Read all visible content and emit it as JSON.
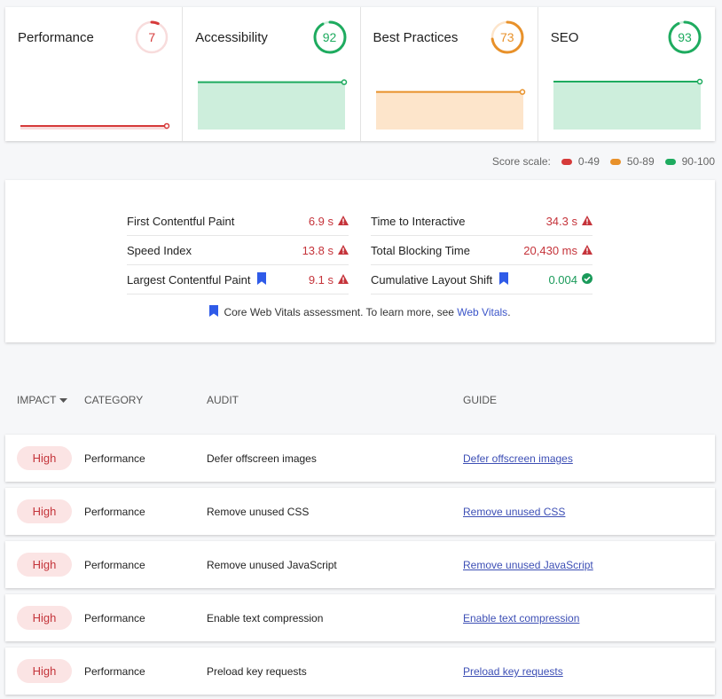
{
  "colors": {
    "poor": "#d63a3a",
    "average": "#e8912a",
    "good": "#1eab5f",
    "poor_fill": "#f8dcdc",
    "average_fill": "#fde5cb",
    "good_fill": "#cdeedc",
    "link": "#3d4fb5"
  },
  "scores": [
    {
      "title": "Performance",
      "value": "7",
      "score": 7,
      "rating": "poor"
    },
    {
      "title": "Accessibility",
      "value": "92",
      "score": 92,
      "rating": "good"
    },
    {
      "title": "Best Practices",
      "value": "73",
      "score": 73,
      "rating": "average"
    },
    {
      "title": "SEO",
      "value": "93",
      "score": 93,
      "rating": "good"
    }
  ],
  "score_scale": {
    "label": "Score scale:",
    "ranges": [
      {
        "label": "0-49",
        "rating": "poor"
      },
      {
        "label": "50-89",
        "rating": "average"
      },
      {
        "label": "90-100",
        "rating": "good"
      }
    ]
  },
  "metrics": [
    {
      "name": "First Contentful Paint",
      "value": "6.9 s",
      "status": "bad",
      "core_web_vital": false
    },
    {
      "name": "Time to Interactive",
      "value": "34.3 s",
      "status": "bad",
      "core_web_vital": false
    },
    {
      "name": "Speed Index",
      "value": "13.8 s",
      "status": "bad",
      "core_web_vital": false
    },
    {
      "name": "Total Blocking Time",
      "value": "20,430 ms",
      "status": "bad",
      "core_web_vital": false
    },
    {
      "name": "Largest Contentful Paint",
      "value": "9.1 s",
      "status": "bad",
      "core_web_vital": true
    },
    {
      "name": "Cumulative Layout Shift",
      "value": "0.004",
      "status": "good",
      "core_web_vital": true
    }
  ],
  "cwv_note": {
    "text": "Core Web Vitals assessment. To learn more, see ",
    "link": "Web Vitals",
    "suffix": "."
  },
  "table": {
    "headers": {
      "impact": "IMPACT",
      "category": "CATEGORY",
      "audit": "AUDIT",
      "guide": "GUIDE"
    },
    "rows": [
      {
        "impact": "High",
        "category": "Performance",
        "audit": "Defer offscreen images",
        "guide": "Defer offscreen images"
      },
      {
        "impact": "High",
        "category": "Performance",
        "audit": "Remove unused CSS",
        "guide": "Remove unused CSS"
      },
      {
        "impact": "High",
        "category": "Performance",
        "audit": "Remove unused JavaScript",
        "guide": "Remove unused JavaScript"
      },
      {
        "impact": "High",
        "category": "Performance",
        "audit": "Enable text compression",
        "guide": "Enable text compression"
      },
      {
        "impact": "High",
        "category": "Performance",
        "audit": "Preload key requests",
        "guide": "Preload key requests"
      }
    ]
  }
}
